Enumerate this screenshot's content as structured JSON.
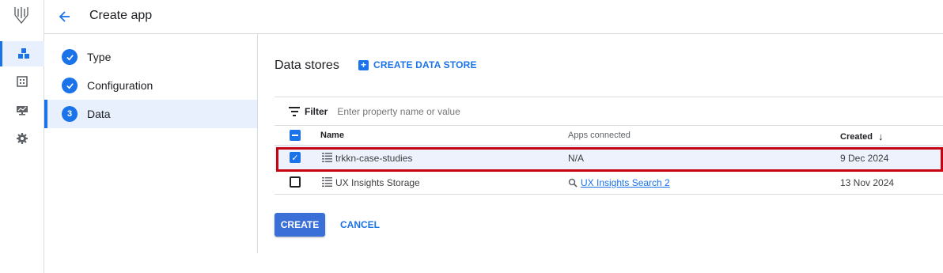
{
  "header": {
    "title": "Create app",
    "back_icon": "arrow-back-icon"
  },
  "rail": {
    "items": [
      {
        "icon": "cubes-icon",
        "active": true
      },
      {
        "icon": "grid-icon",
        "active": false
      },
      {
        "icon": "monitor-icon",
        "active": false
      },
      {
        "icon": "gear-icon",
        "active": false
      }
    ]
  },
  "stepper": {
    "steps": [
      {
        "label": "Type",
        "state": "done"
      },
      {
        "label": "Configuration",
        "state": "done"
      },
      {
        "label": "Data",
        "state": "active",
        "number": "3"
      }
    ]
  },
  "main": {
    "title": "Data stores",
    "create_data_store_label": "CREATE DATA STORE",
    "filter": {
      "label": "Filter",
      "placeholder": "Enter property name or value"
    },
    "table": {
      "columns": {
        "name": "Name",
        "apps": "Apps connected",
        "created": "Created",
        "sort_icon": "arrow-down-icon"
      },
      "rows": [
        {
          "name": "trkkn-case-studies",
          "apps": "N/A",
          "created": "9 Dec 2024",
          "checked": true
        },
        {
          "name": "UX Insights Storage",
          "apps": "UX Insights Search 2",
          "created": "13 Nov 2024",
          "checked": false
        }
      ]
    },
    "buttons": {
      "create": "CREATE",
      "cancel": "CANCEL"
    }
  },
  "colors": {
    "accent": "#1a73e8",
    "highlight": "#c5040f",
    "primary_button": "#3b6fd8"
  }
}
